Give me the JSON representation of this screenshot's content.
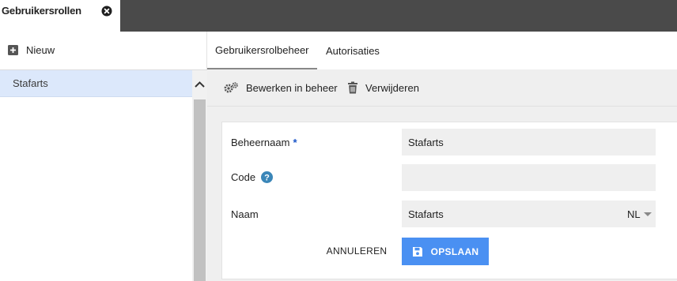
{
  "top_tab": {
    "title": "Gebruikersrollen"
  },
  "sidebar": {
    "new_label": "Nieuw",
    "items": [
      {
        "label": "Stafarts",
        "selected": true
      }
    ]
  },
  "tabs": [
    {
      "label": "Gebruikersrolbeheer",
      "active": true
    },
    {
      "label": "Autorisaties",
      "active": false
    }
  ],
  "toolbar": {
    "edit_label": "Bewerken in beheer",
    "delete_label": "Verwijderen"
  },
  "form": {
    "beheernaam": {
      "label": "Beheernaam",
      "required_mark": "*",
      "value": "Stafarts"
    },
    "code": {
      "label": "Code",
      "value": ""
    },
    "naam": {
      "label": "Naam",
      "value": "Stafarts",
      "language": "NL"
    },
    "cancel_label": "ANNULEREN",
    "save_label": "OPSLAAN"
  },
  "colors": {
    "topbar": "#4a4a4a",
    "selected_item": "#dce8fb",
    "save_button": "#4a90f2",
    "required_mark": "#1a55c9",
    "help_icon": "#3a86b8"
  }
}
